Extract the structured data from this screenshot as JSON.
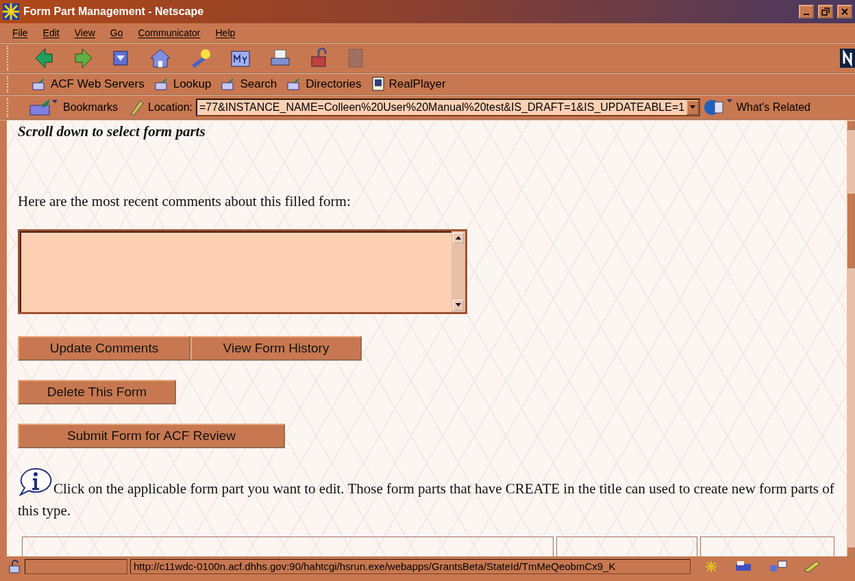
{
  "window": {
    "title": "Form Part Management - Netscape"
  },
  "menu": [
    "File",
    "Edit",
    "View",
    "Go",
    "Communicator",
    "Help"
  ],
  "personal_toolbar": [
    {
      "kind": "folder",
      "label": "ACF Web Servers"
    },
    {
      "kind": "folder",
      "label": "Lookup"
    },
    {
      "kind": "folder",
      "label": "Search"
    },
    {
      "kind": "folder",
      "label": "Directories"
    },
    {
      "kind": "app",
      "label": "RealPlayer"
    }
  ],
  "location_bar": {
    "bookmarks": "Bookmarks",
    "label": "Location:",
    "url": "=77&INSTANCE_NAME=Colleen%20User%20Manual%20test&IS_DRAFT=1&IS_UPDATEABLE=1",
    "whats_related": "What's Related"
  },
  "content": {
    "heading": "Scroll down to select form parts",
    "comments_label": "Here are the most recent comments about this filled form:",
    "button_rows": [
      [
        "Update Comments",
        "View Form History"
      ],
      [
        "Delete This Form"
      ],
      [
        "Submit Form for ACF Review"
      ]
    ],
    "info_text": "Click on the applicable form part you want to edit. Those form parts that have CREATE in the title can used to create new form parts of this type."
  },
  "status_bar": {
    "url": "http://c11wdc-0100n.acf.dhhs.gov:90/hahtcgi/hsrun.exe/webapps/GrantsBeta/StateId/TmMeQeobmCx9_K"
  }
}
